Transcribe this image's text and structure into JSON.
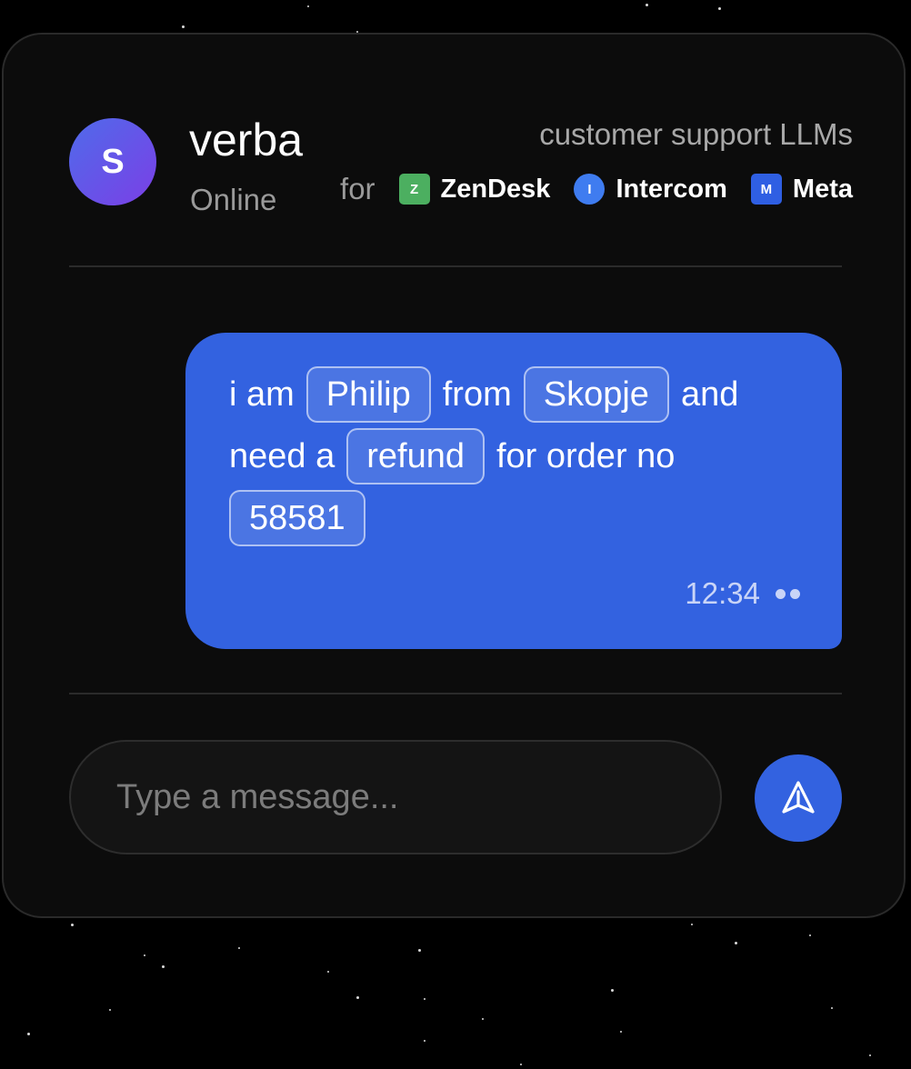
{
  "header": {
    "avatar_initial": "S",
    "app_name": "verba",
    "status": "Online",
    "tagline": "customer support LLMs",
    "for_label": "for",
    "platforms": [
      {
        "badge": "Z",
        "name": "ZenDesk",
        "color": "#4caf60"
      },
      {
        "badge": "I",
        "name": "Intercom",
        "color": "#3f7cf0"
      },
      {
        "badge": "M",
        "name": "Meta",
        "color": "#2f5fe3"
      }
    ]
  },
  "message": {
    "segments": [
      {
        "text": "i am",
        "entity": false
      },
      {
        "text": "Philip",
        "entity": true
      },
      {
        "text": "from",
        "entity": false
      },
      {
        "text": "Skopje",
        "entity": true
      },
      {
        "text": "and",
        "entity": false
      },
      {
        "text": "need a",
        "entity": false
      },
      {
        "text": "refund",
        "entity": true
      },
      {
        "text": "for order no",
        "entity": false
      },
      {
        "text": "58581",
        "entity": true
      }
    ],
    "time": "12:34",
    "status_icon": "double-dot-delivered-icon"
  },
  "composer": {
    "placeholder": "Type a message...",
    "value": "",
    "send_icon": "send-arrow-icon"
  },
  "colors": {
    "accent": "#3362e0",
    "card_bg": "#0c0c0c"
  }
}
